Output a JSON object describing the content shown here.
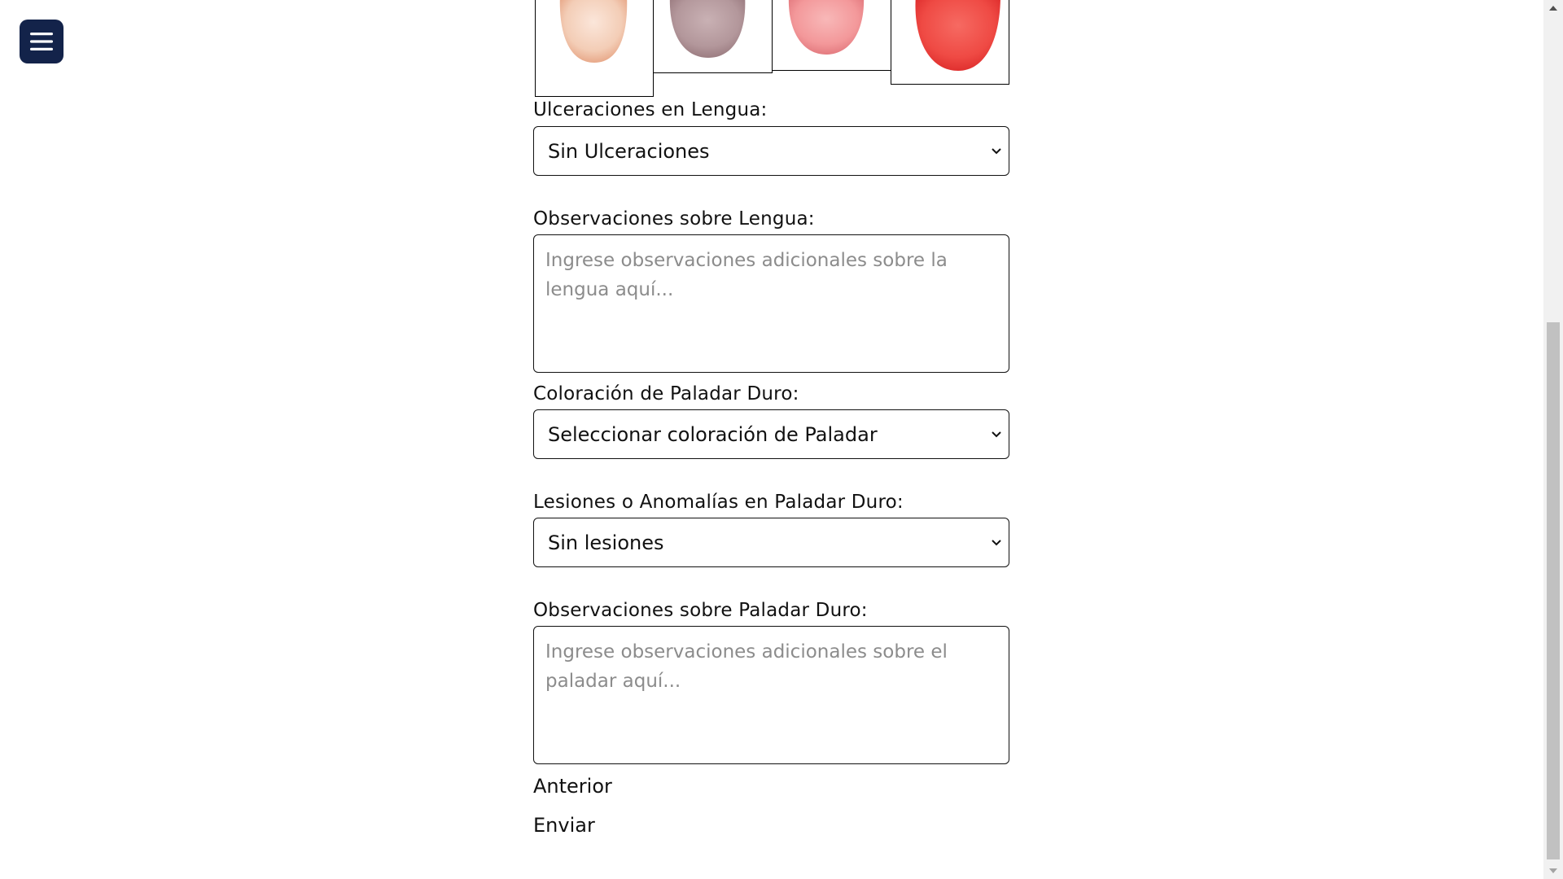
{
  "menu": {
    "icon": "hamburger-menu-icon"
  },
  "tongue_colors": [
    {
      "name": "pale-tongue",
      "color": "#f3cdb6"
    },
    {
      "name": "grayish-tongue",
      "color": "#b3979b"
    },
    {
      "name": "pink-tongue",
      "color": "#f3989a"
    },
    {
      "name": "red-tongue",
      "color": "#ef4a44"
    }
  ],
  "ulceraciones": {
    "label": "Ulceraciones en Lengua:",
    "selected": "Sin Ulceraciones"
  },
  "obs_lengua": {
    "label": "Observaciones sobre Lengua:",
    "placeholder": "Ingrese observaciones adicionales sobre la lengua aquí..."
  },
  "coloracion_paladar": {
    "label": "Coloración de Paladar Duro:",
    "selected": "Seleccionar coloración de Paladar"
  },
  "lesiones_paladar": {
    "label": "Lesiones o Anomalías en Paladar Duro:",
    "selected": "Sin lesiones"
  },
  "obs_paladar": {
    "label": "Observaciones sobre Paladar Duro:",
    "placeholder": "Ingrese observaciones adicionales sobre el paladar aquí..."
  },
  "nav": {
    "previous_label": "Anterior",
    "submit_label": "Enviar"
  }
}
